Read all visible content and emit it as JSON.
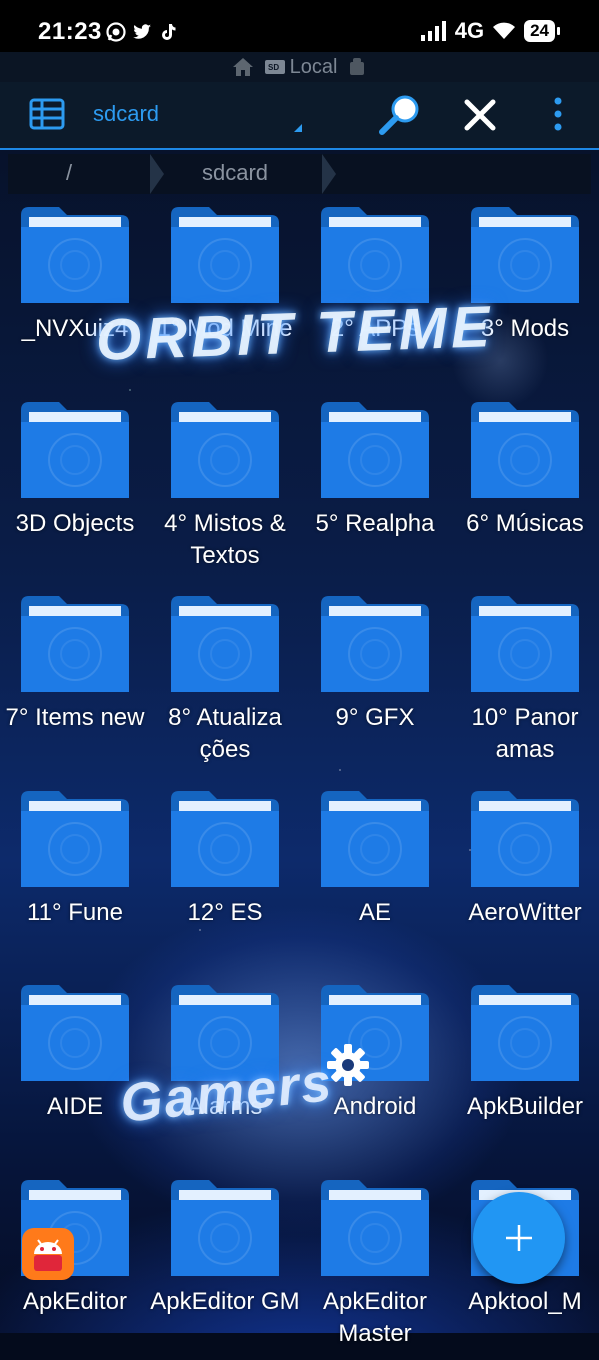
{
  "status_bar": {
    "time": "21:23",
    "network": "4G",
    "battery": "24"
  },
  "location_bar": {
    "label": "Local"
  },
  "toolbar": {
    "path_title": "sdcard"
  },
  "breadcrumb": {
    "root": "/",
    "current": "sdcard"
  },
  "overlay_text": {
    "top": "ORBIT TEME",
    "bottom": "Gamers"
  },
  "folders": [
    "_NVXuiz4",
    "1° Mod Mine",
    "2° APPs",
    "3° Mods",
    "3D Objects",
    "4° Mistos & Textos",
    "5° Realpha",
    "6° Músicas",
    "7° Items new",
    "8° Atualiza ções",
    "9° GFX",
    "10° Panor amas",
    "11° Fune",
    "12° ES",
    "AE",
    "AeroWitter",
    "AIDE",
    "Alarms",
    "Android",
    "ApkBuilder",
    "ApkEditor",
    "ApkEditor GM",
    "ApkEditor Master",
    "Apktool_M"
  ],
  "colors": {
    "accent": "#1e88e5",
    "folder": "#1976e0",
    "fab": "#2196f3"
  }
}
